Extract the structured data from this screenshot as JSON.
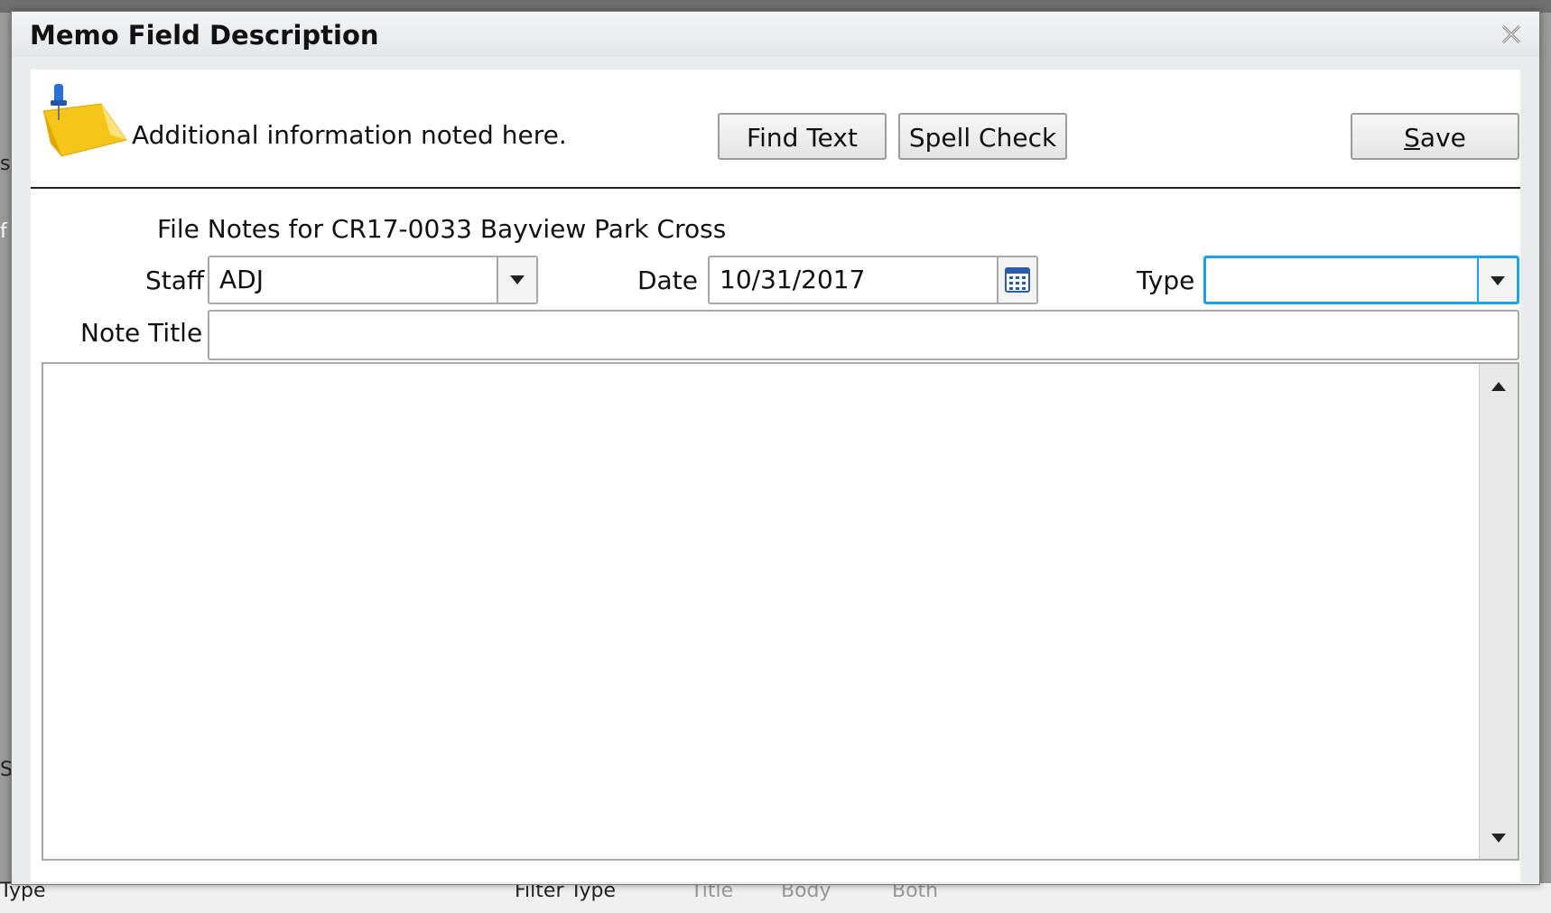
{
  "dialog": {
    "title": "Memo Field Description",
    "close_icon": "close-icon"
  },
  "header": {
    "info_text": "Additional information noted here.",
    "icon": "sticky-note-pin-icon",
    "find_label": "Find Text",
    "spell_label": "Spell Check",
    "save_label": "Save",
    "save_accesskey": "S"
  },
  "form": {
    "heading": "File Notes for CR17-0033 Bayview Park Cross",
    "staff_label": "Staff",
    "staff_value": "ADJ",
    "date_label": "Date",
    "date_value": "10/31/2017",
    "type_label": "Type",
    "type_value": "",
    "note_title_label": "Note Title",
    "note_title_value": "",
    "memo_value": ""
  },
  "background": {
    "left_letters": [
      "s",
      "f",
      "S"
    ],
    "bottom_type": "Type",
    "bottom_filter": "Filter Type",
    "radio_title": "Title",
    "radio_body": "Body",
    "radio_both": "Both"
  },
  "colors": {
    "focus_border": "#1aa3e8",
    "note_yellow": "#f5c518",
    "pin_blue": "#2a6fd6"
  }
}
